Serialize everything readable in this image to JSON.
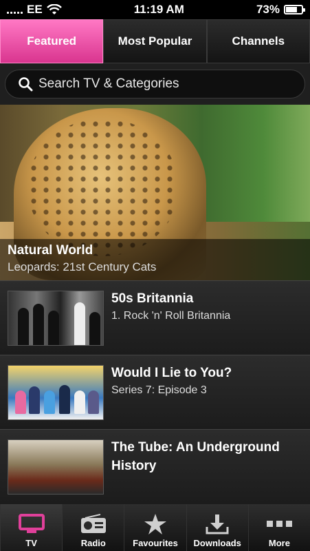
{
  "status": {
    "carrier": "EE",
    "time": "11:19 AM",
    "battery": "73%",
    "battery_level": 0.73
  },
  "tabs": [
    {
      "label": "Featured",
      "active": true
    },
    {
      "label": "Most Popular",
      "active": false
    },
    {
      "label": "Channels",
      "active": false
    }
  ],
  "search": {
    "text": "Search TV & Categories"
  },
  "hero": {
    "title": "Natural World",
    "subtitle": "Leopards: 21st Century Cats"
  },
  "programmes": [
    {
      "title": "50s Britannia",
      "subtitle": "1. Rock 'n' Roll Britannia"
    },
    {
      "title": "Would I Lie to You?",
      "subtitle": "Series 7: Episode 3"
    },
    {
      "title": "The Tube: An Underground History",
      "subtitle": ""
    }
  ],
  "bottom_nav": [
    {
      "label": "TV",
      "icon": "tv-icon",
      "active": true
    },
    {
      "label": "Radio",
      "icon": "radio-icon",
      "active": false
    },
    {
      "label": "Favourites",
      "icon": "star-icon",
      "active": false
    },
    {
      "label": "Downloads",
      "icon": "download-icon",
      "active": false
    },
    {
      "label": "More",
      "icon": "more-icon",
      "active": false
    }
  ],
  "colors": {
    "accent": "#e0409a",
    "background": "#1c1c1c"
  }
}
